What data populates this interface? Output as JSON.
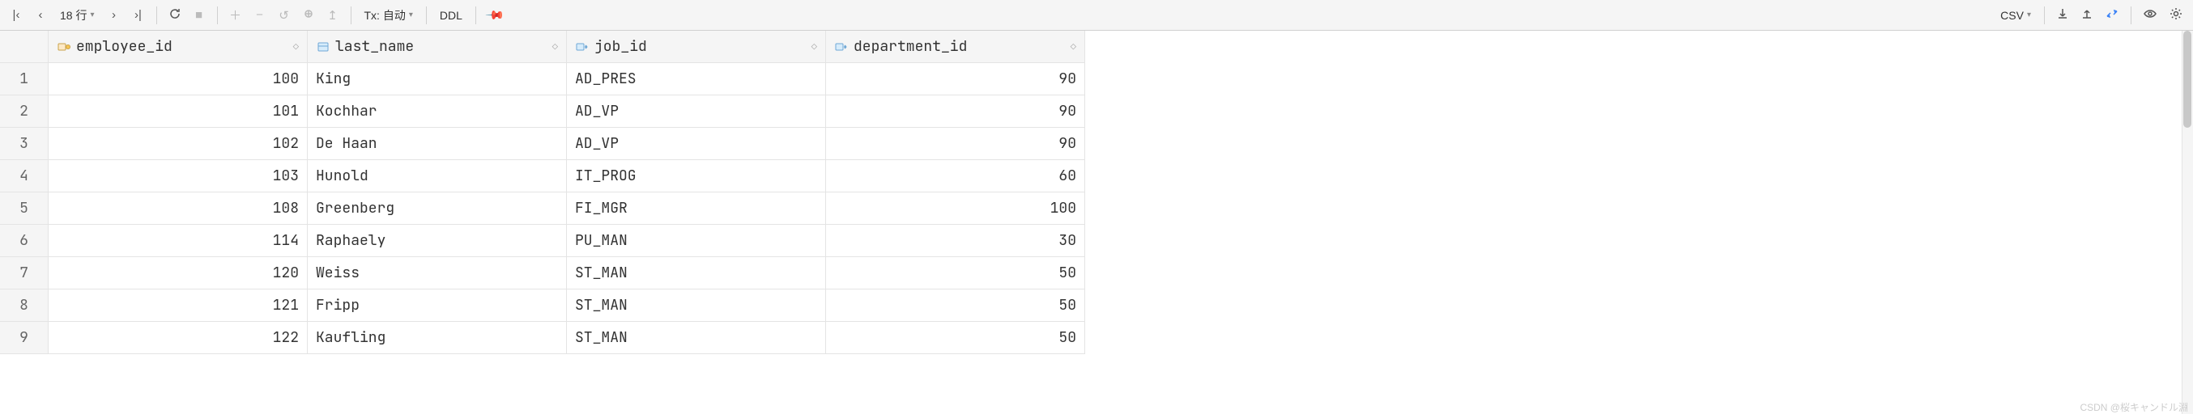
{
  "toolbar": {
    "row_indicator": "18 行",
    "tx_label": "Tx: 自动",
    "ddl_label": "DDL",
    "export_label": "CSV"
  },
  "columns": [
    {
      "name": "employee_id",
      "align": "num",
      "icon": "pk"
    },
    {
      "name": "last_name",
      "align": "txt",
      "icon": "col"
    },
    {
      "name": "job_id",
      "align": "txt",
      "icon": "fk"
    },
    {
      "name": "department_id",
      "align": "num",
      "icon": "fk"
    }
  ],
  "rows": [
    {
      "n": "1",
      "cells": [
        "100",
        "King",
        "AD_PRES",
        "90"
      ]
    },
    {
      "n": "2",
      "cells": [
        "101",
        "Kochhar",
        "AD_VP",
        "90"
      ]
    },
    {
      "n": "3",
      "cells": [
        "102",
        "De Haan",
        "AD_VP",
        "90"
      ]
    },
    {
      "n": "4",
      "cells": [
        "103",
        "Hunold",
        "IT_PROG",
        "60"
      ]
    },
    {
      "n": "5",
      "cells": [
        "108",
        "Greenberg",
        "FI_MGR",
        "100"
      ]
    },
    {
      "n": "6",
      "cells": [
        "114",
        "Raphaely",
        "PU_MAN",
        "30"
      ]
    },
    {
      "n": "7",
      "cells": [
        "120",
        "Weiss",
        "ST_MAN",
        "50"
      ]
    },
    {
      "n": "8",
      "cells": [
        "121",
        "Fripp",
        "ST_MAN",
        "50"
      ]
    },
    {
      "n": "9",
      "cells": [
        "122",
        "Kaufling",
        "ST_MAN",
        "50"
      ]
    }
  ],
  "watermark": "CSDN @桜キャンドル淵"
}
